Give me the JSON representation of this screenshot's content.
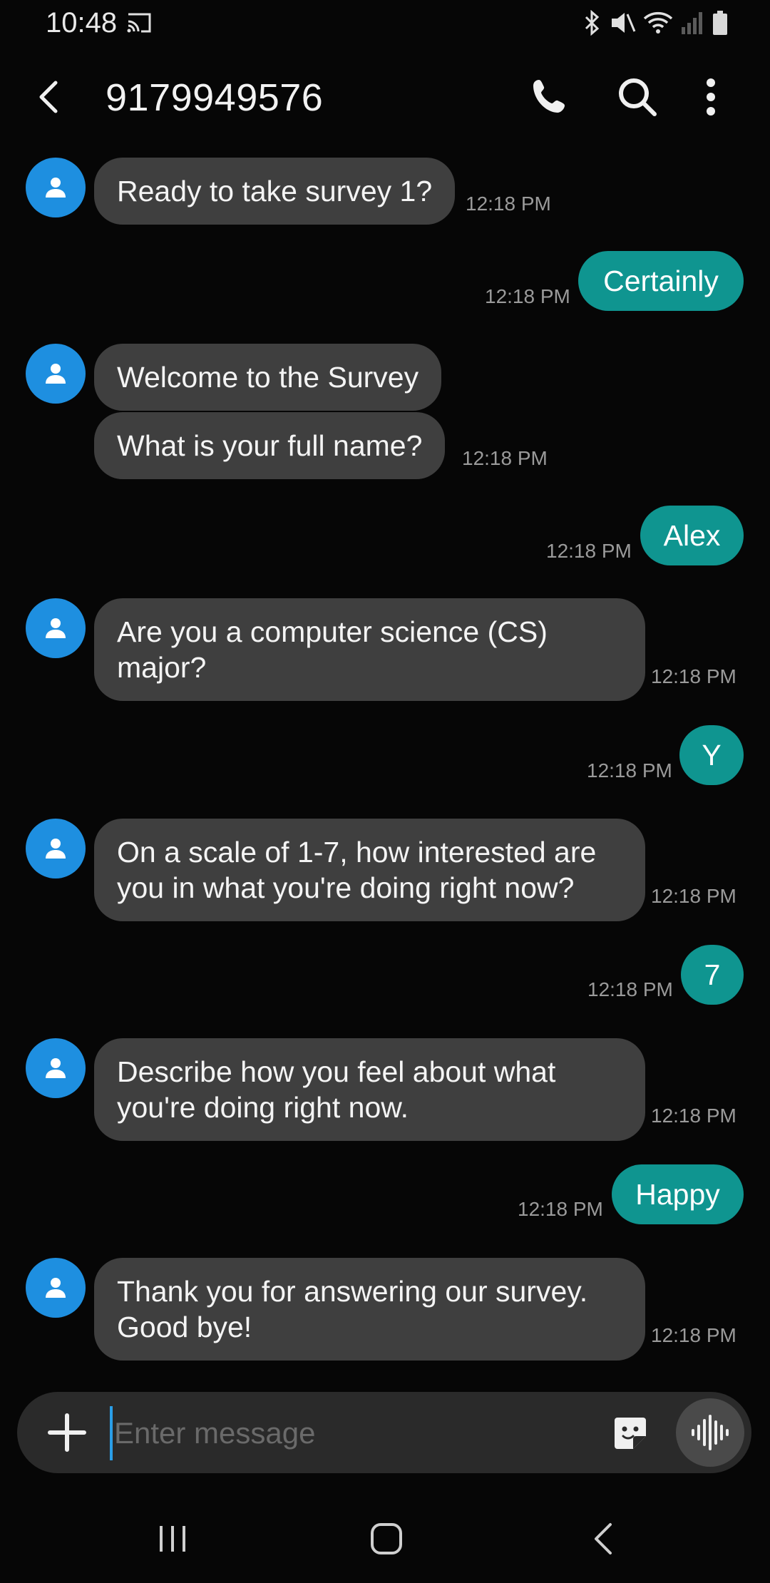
{
  "status_bar": {
    "time": "10:48",
    "icons": [
      "cast-icon",
      "bluetooth-icon",
      "mute-icon",
      "wifi-icon",
      "signal-icon",
      "battery-icon"
    ]
  },
  "header": {
    "title": "9179949576",
    "icons": [
      "back-arrow-icon",
      "phone-icon",
      "search-icon",
      "more-vert-icon"
    ]
  },
  "messages": [
    {
      "type": "incoming",
      "texts": [
        "Ready to take survey 1?"
      ],
      "time": "12:18 PM"
    },
    {
      "type": "outgoing",
      "text": "Certainly",
      "time": "12:18 PM"
    },
    {
      "type": "incoming",
      "texts": [
        "Welcome to the Survey",
        "What is your full name?"
      ],
      "time": "12:18 PM"
    },
    {
      "type": "outgoing",
      "text": "Alex",
      "time": "12:18 PM"
    },
    {
      "type": "incoming",
      "texts": [
        "Are you a computer science (CS)\nmajor?"
      ],
      "time": "12:18 PM"
    },
    {
      "type": "outgoing",
      "text": "Y",
      "time": "12:18 PM"
    },
    {
      "type": "incoming",
      "texts": [
        "On a scale of 1-7, how interested are\nyou in what you're doing right now?"
      ],
      "time": "12:18 PM"
    },
    {
      "type": "outgoing",
      "text": "7",
      "time": "12:18 PM"
    },
    {
      "type": "incoming",
      "texts": [
        "Describe how you feel about what\nyou're doing right now."
      ],
      "time": "12:18 PM"
    },
    {
      "type": "outgoing",
      "text": "Happy",
      "time": "12:18 PM"
    },
    {
      "type": "incoming",
      "texts": [
        "Thank you for answering our survey.\nGood bye!"
      ],
      "time": "12:18 PM"
    }
  ],
  "composer": {
    "placeholder": "Enter message",
    "icons": [
      "plus-icon",
      "sticker-icon",
      "voice-input-icon"
    ]
  },
  "nav_bar": {
    "icons": [
      "recent-apps-icon",
      "home-icon",
      "back-icon"
    ]
  },
  "colors": {
    "background": "#060606",
    "incoming_bubble": "#3f3f3f",
    "outgoing_bubble": "#0f9590",
    "avatar": "#1e8fe0",
    "timestamp": "#9a9a9a"
  }
}
